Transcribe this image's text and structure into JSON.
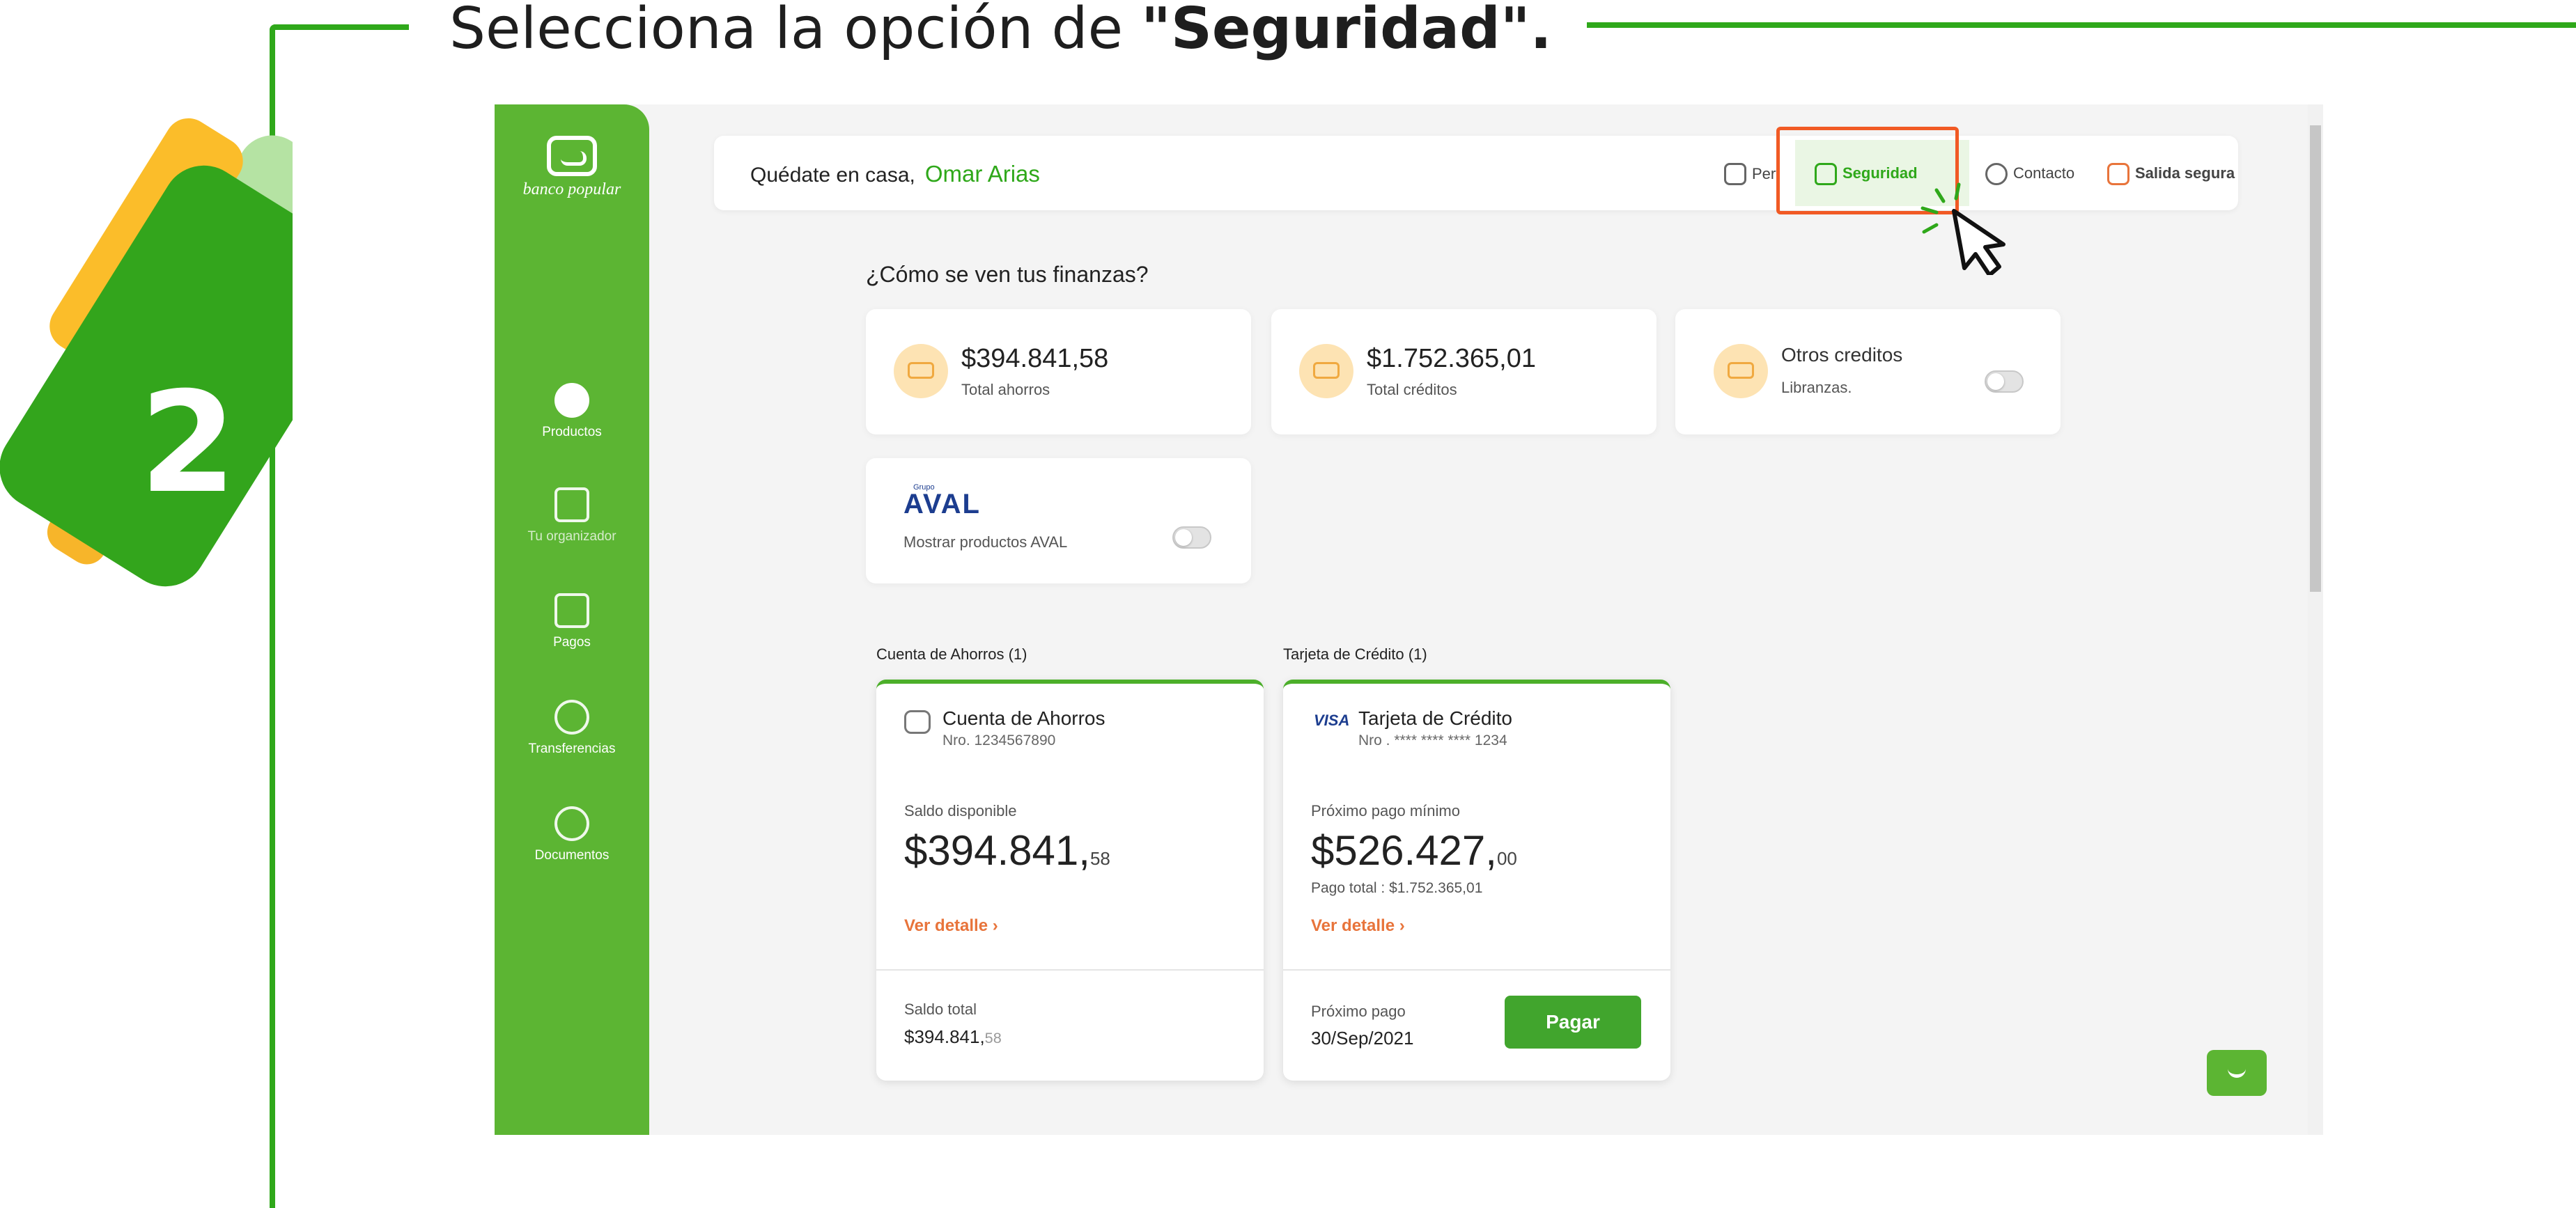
{
  "instruction": {
    "prefix": "Selecciona la opción de ",
    "emphasis": "\"Seguridad\".",
    "suffix": ""
  },
  "step": {
    "number": "2"
  },
  "brand": {
    "name": "banco popular"
  },
  "sidebar": {
    "items": [
      {
        "label": "Productos",
        "icon": "smile-bag-icon"
      },
      {
        "label": "Tu organizador",
        "icon": "wallet-icon"
      },
      {
        "label": "Pagos",
        "icon": "receipt-icon"
      },
      {
        "label": "Transferencias",
        "icon": "dollar-circle-icon"
      },
      {
        "label": "Documentos",
        "icon": "swap-circle-icon"
      }
    ]
  },
  "header": {
    "greeting": "Quédate en casa,",
    "user_name": "Omar Arias",
    "nav": {
      "perfil": "Perfil",
      "seguridad": "Seguridad",
      "contacto": "Contacto",
      "salida": "Salida segura"
    }
  },
  "finances": {
    "title": "¿Cómo se ven tus finanzas?",
    "ahorros_amount": "$394.841,58",
    "ahorros_label": "Total ahorros",
    "creditos_amount": "$1.752.365,01",
    "creditos_label": "Total créditos",
    "otros_title": "Otros creditos",
    "otros_label": "Libranzas.",
    "aval_brand": "AVAL",
    "aval_sup": "Grupo",
    "aval_label": "Mostrar productos AVAL"
  },
  "savings_account": {
    "section": "Cuenta de Ahorros (1)",
    "name": "Cuenta de Ahorros",
    "number": "Nro. 1234567890",
    "balance_label": "Saldo disponible",
    "balance_main": "$394.841,",
    "balance_cents": "58",
    "link": "Ver detalle",
    "total_label": "Saldo total",
    "total_main": "$394.841,",
    "total_cents": "58"
  },
  "credit_card": {
    "section": "Tarjeta de Crédito (1)",
    "brand": "VISA",
    "name": "Tarjeta de Crédito",
    "number": "Nro . **** **** **** 1234",
    "min_label": "Próximo pago mínimo",
    "min_main": "$526.427,",
    "min_cents": "00",
    "total_pay": "Pago total : $1.752.365,01",
    "link": "Ver detalle",
    "next_label": "Próximo pago",
    "next_date": "30/Sep/2021",
    "pay_button": "Pagar"
  },
  "colors": {
    "brand_green": "#5cb533",
    "frame_green": "#2fa81a",
    "highlight": "#f15a24",
    "link_orange": "#e8743b"
  }
}
